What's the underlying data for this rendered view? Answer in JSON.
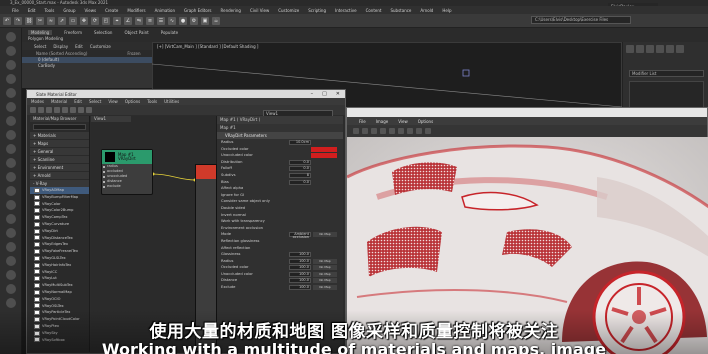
{
  "app": {
    "title": "3_Ex_00000_Start.max - Autodesk 3ds Max 2021",
    "menus": [
      "File",
      "Edit",
      "Tools",
      "Group",
      "Views",
      "Create",
      "Modifiers",
      "Animation",
      "Graph Editors",
      "Rendering",
      "Civil View",
      "Customize",
      "Scripting",
      "Interactive",
      "Content",
      "Substance",
      "Arnold",
      "Help"
    ],
    "user": "ElvisDauley",
    "workspace_field": "C:\\Users\\Elvis\\Desktop\\Exercise Files",
    "ribbon_tabs": [
      "Modeling",
      "Freeform",
      "Selection",
      "Object Paint",
      "Populate"
    ],
    "ribbon_sub": "Polygon Modeling"
  },
  "scene_explorer": {
    "menu": [
      "Select",
      "Display",
      "Edit",
      "Customize"
    ],
    "columns": [
      "Name (Sorted Ascending)",
      "Frozen"
    ],
    "rows": [
      "0 (default)",
      "CarBody"
    ]
  },
  "viewport": {
    "label": "[+] [VirtCam_Main ] [Standard ] [Default Shading ]"
  },
  "command_panel": {
    "modifier_list": "Modifier List"
  },
  "slate": {
    "title": "Slate Material Editor",
    "window_controls": [
      "–",
      "□",
      "✕"
    ],
    "menus": [
      "Modes",
      "Material",
      "Edit",
      "Select",
      "View",
      "Options",
      "Tools",
      "Utilities"
    ],
    "view_name": "View1",
    "browser_title": "Material/Map Browser",
    "browser_categories": [
      "+ Materials",
      "+ Maps",
      "+ General",
      "+ Scanline",
      "+ Environment",
      "+ Arnold",
      "- V-Ray"
    ],
    "browser_items": [
      "VRayAOMap",
      "VRayBumpFilterMap",
      "VRayColor",
      "VRayColor2Bump",
      "VRayCompTex",
      "VRayCurvature",
      "VRayDirt",
      "VRayDistanceTex",
      "VRayEdgesTex",
      "VRayFakeFresnelTex",
      "VRayGLSLTex",
      "VRayHairInfoTex",
      "VRayICC",
      "VRayLut",
      "VRayMultiSubTex",
      "VRayNormalMap",
      "VRayOCIO",
      "VRayOSLTex",
      "VRayParticleTex",
      "VRayPointCloudColor",
      "VRayPtex",
      "VRaySky",
      "VRaySoftbox"
    ],
    "graph_tab": "View1",
    "node_title": "Map #1\nVRayDirt",
    "node_ports": [
      "radius",
      "occluded",
      "unoccluded",
      "distance",
      "exclude"
    ],
    "params_title": "Map #1 ( VRayDirt )",
    "params_sub": "Map #1",
    "params_rollout": "VRayDirt Parameters",
    "params": [
      {
        "label": "Radius",
        "value": "10.0cm",
        "kind": "value"
      },
      {
        "label": "Occluded color",
        "kind": "color"
      },
      {
        "label": "Unoccluded color",
        "kind": "color"
      },
      {
        "label": "Distribution",
        "value": "0.0",
        "kind": "value"
      },
      {
        "label": "Falloff",
        "value": "0.0",
        "kind": "value"
      },
      {
        "label": "Subdivs",
        "value": "8",
        "kind": "value"
      },
      {
        "label": "Bias",
        "value": "0.0",
        "kind": "value"
      },
      {
        "label": "Affect alpha",
        "kind": "plain"
      },
      {
        "label": "Ignore for GI",
        "kind": "plain"
      },
      {
        "label": "Consider same object only",
        "kind": "plain"
      },
      {
        "label": "Double sided",
        "kind": "plain"
      },
      {
        "label": "Invert normal",
        "kind": "plain"
      },
      {
        "label": "Work with transparency",
        "kind": "plain"
      },
      {
        "label": "Environment occlusion",
        "kind": "plain"
      },
      {
        "label": "Mode",
        "value": "Ambient occlusion",
        "kind": "map"
      },
      {
        "label": "Reflection glossiness",
        "kind": "plain"
      },
      {
        "label": "Affect reflection",
        "kind": "plain"
      },
      {
        "label": "Glossiness",
        "value": "100.0",
        "kind": "value"
      },
      {
        "label": "Radius",
        "value": "100.0",
        "kind": "map"
      },
      {
        "label": "Occluded color",
        "value": "100.0",
        "kind": "map"
      },
      {
        "label": "Unoccluded color",
        "value": "100.0",
        "kind": "map"
      },
      {
        "label": "Distance",
        "value": "100.0",
        "kind": "map"
      },
      {
        "label": "Exclude",
        "value": "100.0",
        "kind": "map"
      }
    ],
    "no_map": "No Map"
  },
  "render_window": {
    "menus": [
      "File",
      "Image",
      "View",
      "Options"
    ]
  },
  "subtitles": {
    "cn": "使用大量的材质和地图 图像采样和质量控制将被关注",
    "en": "Working with a multitude of materials and maps, image"
  },
  "colors": {
    "node_header": "#2b9a6c",
    "occluded_swatch": "#d11e1e",
    "render_tint": "#c7242a"
  }
}
